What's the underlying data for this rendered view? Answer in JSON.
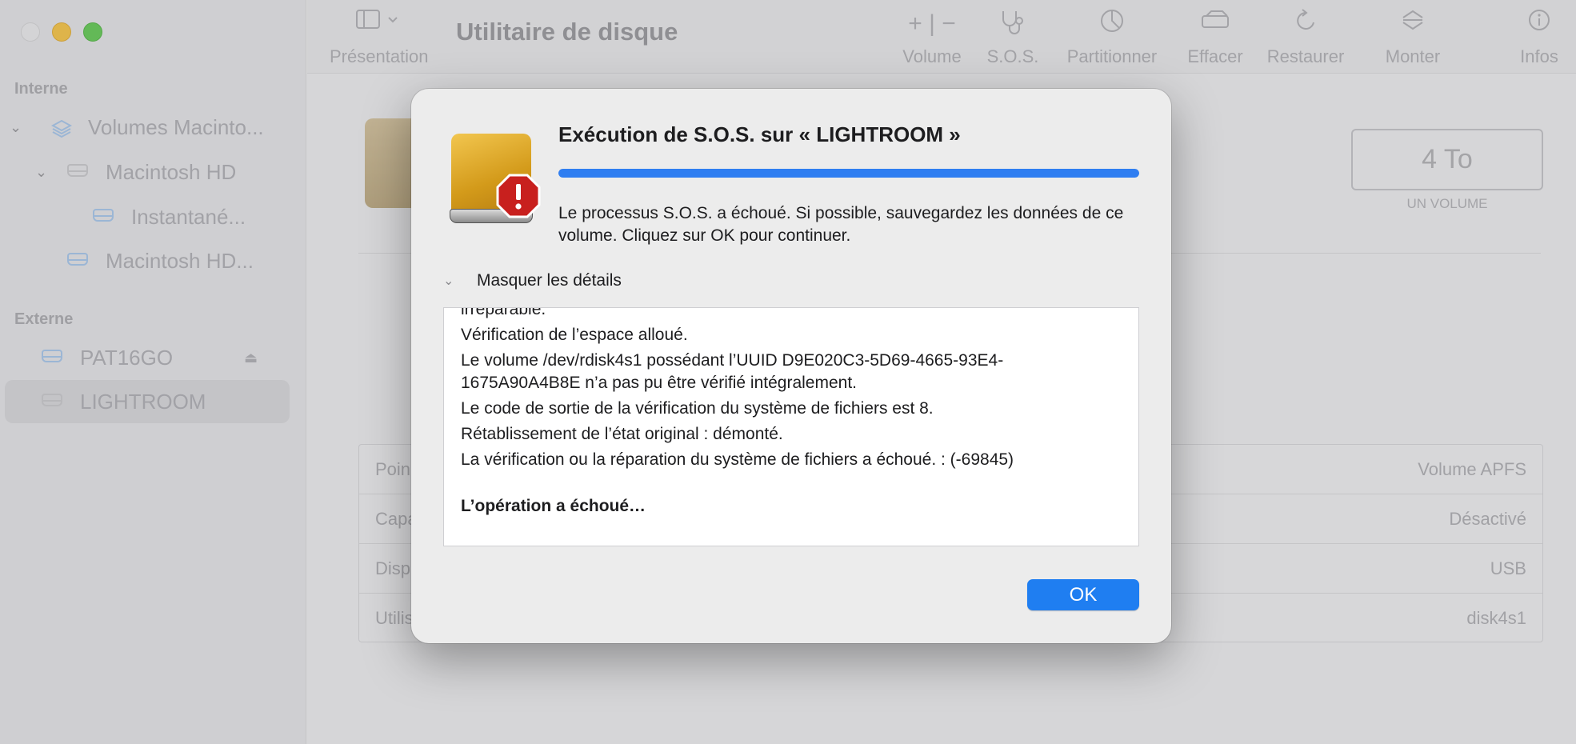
{
  "sidebar": {
    "section_internal": "Interne",
    "section_external": "Externe",
    "items": [
      {
        "label": "Volumes Macinto..."
      },
      {
        "label": "Macintosh HD"
      },
      {
        "label": "Instantané..."
      },
      {
        "label": "Macintosh HD..."
      },
      {
        "label": "PAT16GO"
      },
      {
        "label": "LIGHTROOM"
      }
    ]
  },
  "toolbar": {
    "title": "Utilitaire de disque",
    "presentation": "Présentation",
    "volume": "Volume",
    "sos": "S.O.S.",
    "partition": "Partitionner",
    "erase": "Effacer",
    "restore": "Restaurer",
    "mount": "Monter",
    "info": "Infos"
  },
  "background": {
    "capacity": "4 To",
    "capacity_sub": "UN VOLUME",
    "rows": [
      {
        "left": "Poin",
        "right": "Volume APFS"
      },
      {
        "left": "Capa",
        "right": "Désactivé"
      },
      {
        "left": "Disp",
        "right": "USB"
      },
      {
        "left": "Utilis",
        "right": "disk4s1"
      }
    ]
  },
  "dialog": {
    "title": "Exécution de S.O.S. sur « LIGHTROOM »",
    "progress": 1.0,
    "message": "Le processus S.O.S. a échoué. Si possible, sauvegardez les données de ce volume. Cliquez sur OK pour continuer.",
    "details_toggle": "Masquer les détails",
    "log": [
      "irréparable.",
      "Vérification de l’espace alloué.",
      "Le volume /dev/rdisk4s1 possédant l’UUID D9E020C3-5D69-4665-93E4-1675A90A4B8E n’a pas pu être vérifié intégralement.",
      "Le code de sortie de la vérification du système de fichiers est 8.",
      "Rétablissement de l’état original : démonté.",
      "La vérification ou la réparation du système de fichiers a échoué. : (-69845)"
    ],
    "log_final": "L’opération a échoué…",
    "ok_label": "OK"
  }
}
